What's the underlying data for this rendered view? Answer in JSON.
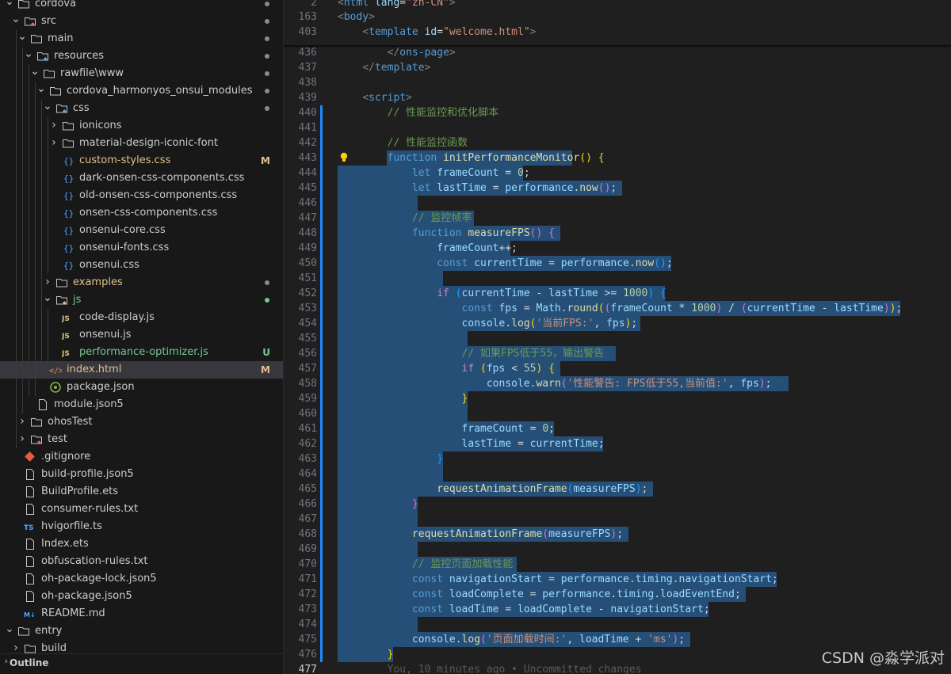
{
  "colors": {
    "modified": "#e2c08d",
    "untracked": "#73c991",
    "selection": "#264f78",
    "folder_dot": "#8c8c8c"
  },
  "explorer": {
    "items": [
      {
        "label": "cordova",
        "depth": 1,
        "kind": "folder",
        "open": true,
        "dot": true
      },
      {
        "label": "src",
        "depth": 2,
        "kind": "folder-src",
        "open": true,
        "dot": true
      },
      {
        "label": "main",
        "depth": 3,
        "kind": "folder",
        "open": true,
        "dot": true
      },
      {
        "label": "resources",
        "depth": 4,
        "kind": "folder-res",
        "open": true,
        "dot": true
      },
      {
        "label": "rawfile\\www",
        "depth": 5,
        "kind": "folder",
        "open": true,
        "dot": true
      },
      {
        "label": "cordova_harmonyos_onsui_modules",
        "depth": 6,
        "kind": "folder",
        "open": true,
        "dot": true
      },
      {
        "label": "css",
        "depth": 7,
        "kind": "folder-css",
        "open": true,
        "dot": true
      },
      {
        "label": "ionicons",
        "depth": 8,
        "kind": "folder",
        "open": false
      },
      {
        "label": "material-design-iconic-font",
        "depth": 8,
        "kind": "folder",
        "open": false
      },
      {
        "label": "custom-styles.css",
        "depth": 8,
        "kind": "css",
        "status": "M",
        "color": "#e2c08d"
      },
      {
        "label": "dark-onsen-css-components.css",
        "depth": 8,
        "kind": "css"
      },
      {
        "label": "old-onsen-css-components.css",
        "depth": 8,
        "kind": "css"
      },
      {
        "label": "onsen-css-components.css",
        "depth": 8,
        "kind": "css"
      },
      {
        "label": "onsenui-core.css",
        "depth": 8,
        "kind": "css"
      },
      {
        "label": "onsenui-fonts.css",
        "depth": 8,
        "kind": "css"
      },
      {
        "label": "onsenui.css",
        "depth": 8,
        "kind": "css"
      },
      {
        "label": "examples",
        "depth": 7,
        "kind": "folder",
        "open": false,
        "dot": true,
        "color": "#e2c08d"
      },
      {
        "label": "js",
        "depth": 7,
        "kind": "folder-js",
        "open": true,
        "dot": true,
        "dotcolor": "#73c991",
        "color": "#73c991"
      },
      {
        "label": "code-display.js",
        "depth": 8,
        "kind": "js"
      },
      {
        "label": "onsenui.js",
        "depth": 8,
        "kind": "js"
      },
      {
        "label": "performance-optimizer.js",
        "depth": 8,
        "kind": "js",
        "status": "U",
        "color": "#73c991"
      },
      {
        "label": "index.html",
        "depth": 6,
        "kind": "html",
        "status": "M",
        "color": "#e2c08d",
        "selected": true
      },
      {
        "label": "package.json",
        "depth": 6,
        "kind": "pkg"
      },
      {
        "label": "module.json5",
        "depth": 4,
        "kind": "json"
      },
      {
        "label": "ohosTest",
        "depth": 3,
        "kind": "folder",
        "open": false
      },
      {
        "label": "test",
        "depth": 3,
        "kind": "folder-test",
        "open": false
      },
      {
        "label": ".gitignore",
        "depth": 2,
        "kind": "git"
      },
      {
        "label": "build-profile.json5",
        "depth": 2,
        "kind": "file"
      },
      {
        "label": "BuildProfile.ets",
        "depth": 2,
        "kind": "file"
      },
      {
        "label": "consumer-rules.txt",
        "depth": 2,
        "kind": "file"
      },
      {
        "label": "hvigorfile.ts",
        "depth": 2,
        "kind": "ts"
      },
      {
        "label": "Index.ets",
        "depth": 2,
        "kind": "file"
      },
      {
        "label": "obfuscation-rules.txt",
        "depth": 2,
        "kind": "file"
      },
      {
        "label": "oh-package-lock.json5",
        "depth": 2,
        "kind": "file"
      },
      {
        "label": "oh-package.json5",
        "depth": 2,
        "kind": "file"
      },
      {
        "label": "README.md",
        "depth": 2,
        "kind": "md"
      },
      {
        "label": "entry",
        "depth": 1,
        "kind": "folder",
        "open": true
      },
      {
        "label": "build",
        "depth": 2,
        "kind": "folder",
        "open": false
      }
    ],
    "outline_label": "Outline"
  },
  "editor": {
    "sticky": [
      {
        "ln": "2",
        "html": "<span class='p'>&lt;</span><span class='t'>html</span> <span class='a'>lang</span><span class='o'>=</span><span class='s'>\"zh-CN\"</span><span class='p'>&gt;</span>"
      },
      {
        "ln": "163",
        "html": "<span class='p'>&lt;</span><span class='t'>body</span><span class='p'>&gt;</span>"
      },
      {
        "ln": "403",
        "html": "    <span class='p'>&lt;</span><span class='t'>template</span> <span class='a'>id</span><span class='o'>=</span><span class='s'>\"welcome.html\"</span><span class='p'>&gt;</span>"
      }
    ],
    "lines": [
      {
        "ln": "436",
        "sel": null,
        "html": "        <span class='p'>&lt;/</span><span class='t'>ons-page</span><span class='p'>&gt;</span>"
      },
      {
        "ln": "437",
        "sel": null,
        "html": "    <span class='p'>&lt;/</span><span class='t'>template</span><span class='p'>&gt;</span>"
      },
      {
        "ln": "438",
        "sel": null,
        "html": ""
      },
      {
        "ln": "439",
        "sel": null,
        "html": "    <span class='p'>&lt;</span><span class='t'>script</span><span class='p'>&gt;</span>"
      },
      {
        "ln": "440",
        "sel": null,
        "mod": true,
        "html": "        <span class='c'>// 性能监控和优化脚本</span>"
      },
      {
        "ln": "441",
        "sel": null,
        "mod": true,
        "html": ""
      },
      {
        "ln": "442",
        "sel": null,
        "mod": true,
        "html": "        <span class='c'>// 性能监控函数</span>"
      },
      {
        "ln": "443",
        "sel": [
          8,
          38
        ],
        "mod": true,
        "bulb": true,
        "html": "        <span class='k'>function</span> <span class='f'>initPerformanceMonitor</span><span class='b1'>()</span> <span class='b1'>{</span>"
      },
      {
        "ln": "444",
        "sel": [
          0,
          30
        ],
        "mod": true,
        "html": "            <span class='k'>let</span> <span class='a'>frameCount</span> <span class='o'>=</span> <span class='n'>0</span><span class='o'>;</span>"
      },
      {
        "ln": "445",
        "sel": [
          0,
          46
        ],
        "mod": true,
        "html": "            <span class='k'>let</span> <span class='a'>lastTime</span> <span class='o'>=</span> <span class='a'>performance</span><span class='o'>.</span><span class='f'>now</span><span class='b2'>()</span><span class='o'>;</span>"
      },
      {
        "ln": "446",
        "sel": [
          0,
          13
        ],
        "mod": true,
        "html": ""
      },
      {
        "ln": "447",
        "sel": [
          0,
          22
        ],
        "mod": true,
        "html": "            <span class='c'>// 监控帧率</span>"
      },
      {
        "ln": "448",
        "sel": [
          0,
          36
        ],
        "mod": true,
        "html": "            <span class='k'>function</span> <span class='f'>measureFPS</span><span class='b2'>()</span> <span class='b2'>{</span>"
      },
      {
        "ln": "449",
        "sel": [
          0,
          28
        ],
        "mod": true,
        "html": "                <span class='a'>frameCount</span><span class='o'>++;</span>"
      },
      {
        "ln": "450",
        "sel": [
          0,
          54
        ],
        "mod": true,
        "html": "                <span class='k'>const</span> <span class='a'>currentTime</span> <span class='o'>=</span> <span class='a'>performance</span><span class='o'>.</span><span class='f'>now</span><span class='b3'>()</span><span class='o'>;</span>"
      },
      {
        "ln": "451",
        "sel": [
          0,
          17
        ],
        "mod": true,
        "html": ""
      },
      {
        "ln": "452",
        "sel": [
          0,
          53
        ],
        "mod": true,
        "html": "                <span class='ctl'>if</span> <span class='b3'>(</span><span class='a'>currentTime</span> <span class='o'>-</span> <span class='a'>lastTime</span> <span class='o'>&gt;=</span> <span class='n'>1000</span><span class='b3'>)</span> <span class='b3'>{</span>"
      },
      {
        "ln": "453",
        "sel": [
          0,
          91
        ],
        "mod": true,
        "html": "                    <span class='k'>const</span> <span class='a'>fps</span> <span class='o'>=</span> <span class='a'>Math</span><span class='o'>.</span><span class='f'>round</span><span class='b1'>(</span><span class='b2'>(</span><span class='a'>frameCount</span> <span class='o'>*</span> <span class='n'>1000</span><span class='b2'>)</span> <span class='o'>/</span> <span class='b2'>(</span><span class='a'>currentTime</span> <span class='o'>-</span> <span class='a'>lastTime</span><span class='b2'>)</span><span class='b1'>)</span><span class='o'>;</span>"
      },
      {
        "ln": "454",
        "sel": [
          0,
          49
        ],
        "mod": true,
        "html": "                    <span class='a'>console</span><span class='o'>.</span><span class='f'>log</span><span class='b1'>(</span><span class='s'>'当前FPS:'</span><span class='o'>,</span> <span class='a'>fps</span><span class='b1'>)</span><span class='o'>;</span>"
      },
      {
        "ln": "455",
        "sel": [
          0,
          21
        ],
        "mod": true,
        "html": ""
      },
      {
        "ln": "456",
        "sel": [
          0,
          45
        ],
        "mod": true,
        "html": "                    <span class='c'>// 如果FPS低于55，输出警告</span>"
      },
      {
        "ln": "457",
        "sel": [
          0,
          36
        ],
        "mod": true,
        "html": "                    <span class='ctl'>if</span> <span class='b1'>(</span><span class='a'>fps</span> <span class='o'>&lt;</span> <span class='n'>55</span><span class='b1'>)</span> <span class='b1'>{</span>"
      },
      {
        "ln": "458",
        "sel": [
          0,
          73
        ],
        "mod": true,
        "html": "                        <span class='a'>console</span><span class='o'>.</span><span class='f'>warn</span><span class='b2'>(</span><span class='s'>'性能警告: FPS低于55,当前值:'</span><span class='o'>,</span> <span class='a'>fps</span><span class='b2'>)</span><span class='o'>;</span>"
      },
      {
        "ln": "459",
        "sel": [
          0,
          21
        ],
        "mod": true,
        "html": "                    <span class='b1'>}</span>"
      },
      {
        "ln": "460",
        "sel": [
          0,
          21
        ],
        "mod": true,
        "html": ""
      },
      {
        "ln": "461",
        "sel": [
          0,
          35
        ],
        "mod": true,
        "html": "                    <span class='a'>frameCount</span> <span class='o'>=</span> <span class='n'>0</span><span class='o'>;</span>"
      },
      {
        "ln": "462",
        "sel": [
          0,
          43
        ],
        "mod": true,
        "html": "                    <span class='a'>lastTime</span> <span class='o'>=</span> <span class='a'>currentTime</span><span class='o'>;</span>"
      },
      {
        "ln": "463",
        "sel": [
          0,
          17
        ],
        "mod": true,
        "html": "                <span class='b3'>}</span>"
      },
      {
        "ln": "464",
        "sel": [
          0,
          17
        ],
        "mod": true,
        "html": ""
      },
      {
        "ln": "465",
        "sel": [
          0,
          51
        ],
        "mod": true,
        "html": "                <span class='f'>requestAnimationFrame</span><span class='b3'>(</span><span class='a'>measureFPS</span><span class='b3'>)</span><span class='o'>;</span>"
      },
      {
        "ln": "466",
        "sel": [
          0,
          13
        ],
        "mod": true,
        "html": "            <span class='b2'>}</span>"
      },
      {
        "ln": "467",
        "sel": [
          0,
          13
        ],
        "mod": true,
        "html": ""
      },
      {
        "ln": "468",
        "sel": [
          0,
          47
        ],
        "mod": true,
        "html": "            <span class='f'>requestAnimationFrame</span><span class='b2'>(</span><span class='a'>measureFPS</span><span class='b2'>)</span><span class='o'>;</span>"
      },
      {
        "ln": "469",
        "sel": [
          0,
          13
        ],
        "mod": true,
        "html": ""
      },
      {
        "ln": "470",
        "sel": [
          0,
          29
        ],
        "mod": true,
        "html": "            <span class='c'>// 监控页面加载性能</span>"
      },
      {
        "ln": "471",
        "sel": [
          0,
          71
        ],
        "mod": true,
        "html": "            <span class='k'>const</span> <span class='a'>navigationStart</span> <span class='o'>=</span> <span class='a'>performance</span><span class='o'>.</span><span class='a'>timing</span><span class='o'>.</span><span class='a'>navigationStart</span><span class='o'>;</span>"
      },
      {
        "ln": "472",
        "sel": [
          0,
          66
        ],
        "mod": true,
        "html": "            <span class='k'>const</span> <span class='a'>loadComplete</span> <span class='o'>=</span> <span class='a'>performance</span><span class='o'>.</span><span class='a'>timing</span><span class='o'>.</span><span class='a'>loadEventEnd</span><span class='o'>;</span>"
      },
      {
        "ln": "473",
        "sel": [
          0,
          60
        ],
        "mod": true,
        "html": "            <span class='k'>const</span> <span class='a'>loadTime</span> <span class='o'>=</span> <span class='a'>loadComplete</span> <span class='o'>-</span> <span class='a'>navigationStart</span><span class='o'>;</span>"
      },
      {
        "ln": "474",
        "sel": [
          0,
          13
        ],
        "mod": true,
        "html": ""
      },
      {
        "ln": "475",
        "sel": [
          0,
          57
        ],
        "mod": true,
        "html": "            <span class='a'>console</span><span class='o'>.</span><span class='f'>log</span><span class='b2'>(</span><span class='s'>'页面加载时间:'</span><span class='o'>,</span> <span class='a'>loadTime</span> <span class='o'>+</span> <span class='s'>'ms'</span><span class='b2'>)</span><span class='o'>;</span>"
      },
      {
        "ln": "476",
        "sel": [
          0,
          9
        ],
        "mod": true,
        "html": "        <span class='b1'>}</span>"
      },
      {
        "ln": "477",
        "sel": null,
        "cur": true,
        "html": "        <span class='ghost'>You, 10 minutes ago • Uncommitted changes</span>"
      }
    ]
  },
  "watermark": "CSDN @淼学派对"
}
